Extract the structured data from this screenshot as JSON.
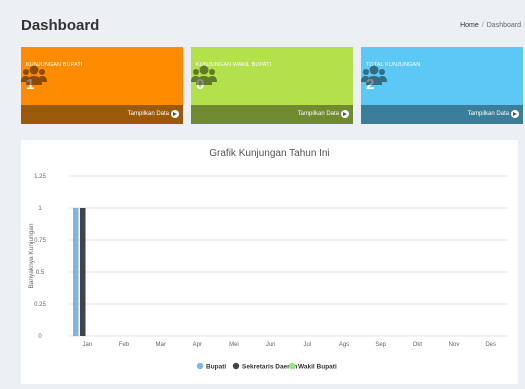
{
  "header": {
    "title": "Dashboard",
    "breadcrumb_home": "Home",
    "breadcrumb_sep": "/",
    "breadcrumb_current": "Dashboard"
  },
  "cards": [
    {
      "label": "KUNJUNGAN BUPATI",
      "value": "1",
      "footer": "Tampilkan Data",
      "color": "#ff8c00",
      "footer_color": "#9a5a0a",
      "icon": "users-icon"
    },
    {
      "label": "KUNJUNGAN WAKIL BUPATI",
      "value": "0",
      "footer": "Tampilkan Data",
      "color": "#b3e04b",
      "footer_color": "#6f8a31",
      "icon": "users-icon"
    },
    {
      "label": "TOTAL KUNJUNGAN",
      "value": "2",
      "footer": "Tampilkan Data",
      "color": "#5bc8f5",
      "footer_color": "#3a7e9a",
      "icon": "users-icon"
    }
  ],
  "chart_data": {
    "type": "bar",
    "title": "Grafik Kunjungan Tahun Ini",
    "ylabel": "Banyaknya Kunjungan",
    "xlabel": "",
    "categories": [
      "Jan",
      "Feb",
      "Mar",
      "Apr",
      "Mei",
      "Jun",
      "Jul",
      "Ags",
      "Sep",
      "Okt",
      "Nov",
      "Des"
    ],
    "series": [
      {
        "name": "Bupati",
        "color": "#7cb5ec",
        "values": [
          1,
          0,
          0,
          0,
          0,
          0,
          0,
          0,
          0,
          0,
          0,
          0
        ]
      },
      {
        "name": "Sekretaris Daerah",
        "color": "#434348",
        "values": [
          1,
          0,
          0,
          0,
          0,
          0,
          0,
          0,
          0,
          0,
          0,
          0
        ]
      },
      {
        "name": "Wakil Bupati",
        "color": "#90ed7d",
        "values": [
          0,
          0,
          0,
          0,
          0,
          0,
          0,
          0,
          0,
          0,
          0,
          0
        ]
      }
    ],
    "yticks": [
      "0",
      "0.25",
      "0.5",
      "0.75",
      "1",
      "1.25"
    ],
    "ylim": [
      0,
      1.25
    ],
    "legend_position": "bottom",
    "grid": true
  }
}
